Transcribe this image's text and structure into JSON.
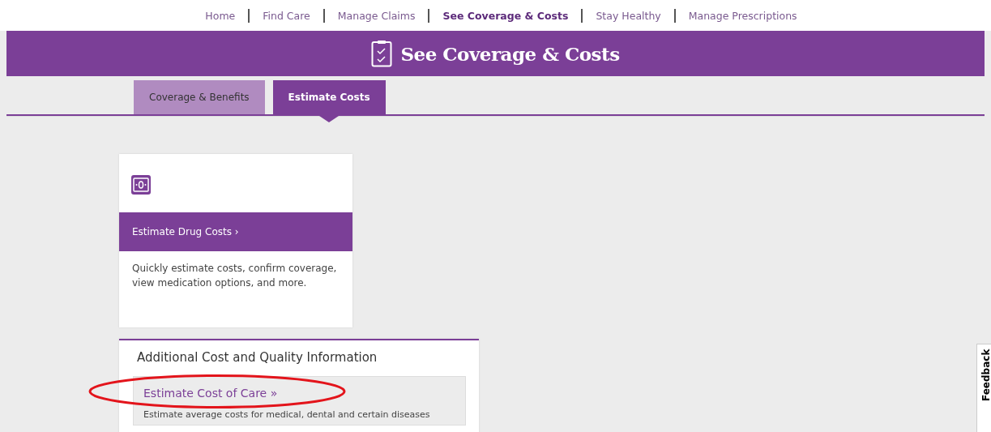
{
  "top_nav": [
    {
      "label": "Home",
      "selected": false
    },
    {
      "label": "Find Care",
      "selected": false
    },
    {
      "label": "Manage Claims",
      "selected": false
    },
    {
      "label": "See Coverage & Costs",
      "selected": true
    },
    {
      "label": "Stay Healthy",
      "selected": false
    },
    {
      "label": "Manage Prescriptions",
      "selected": false
    }
  ],
  "header": {
    "title": "See Coverage & Costs"
  },
  "tabs": [
    {
      "label": "Coverage & Benefits",
      "selected": false
    },
    {
      "label": "Estimate Costs",
      "selected": true
    }
  ],
  "drug_card": {
    "link": "Estimate Drug Costs ›",
    "description": "Quickly estimate costs, confirm coverage, view medication options, and more."
  },
  "additional_panel": {
    "title": "Additional Cost and Quality Information",
    "link": "Estimate Cost of Care »",
    "description": "Estimate average costs for medical, dental and certain diseases"
  },
  "feedback_tab": {
    "label": "Feedback"
  }
}
